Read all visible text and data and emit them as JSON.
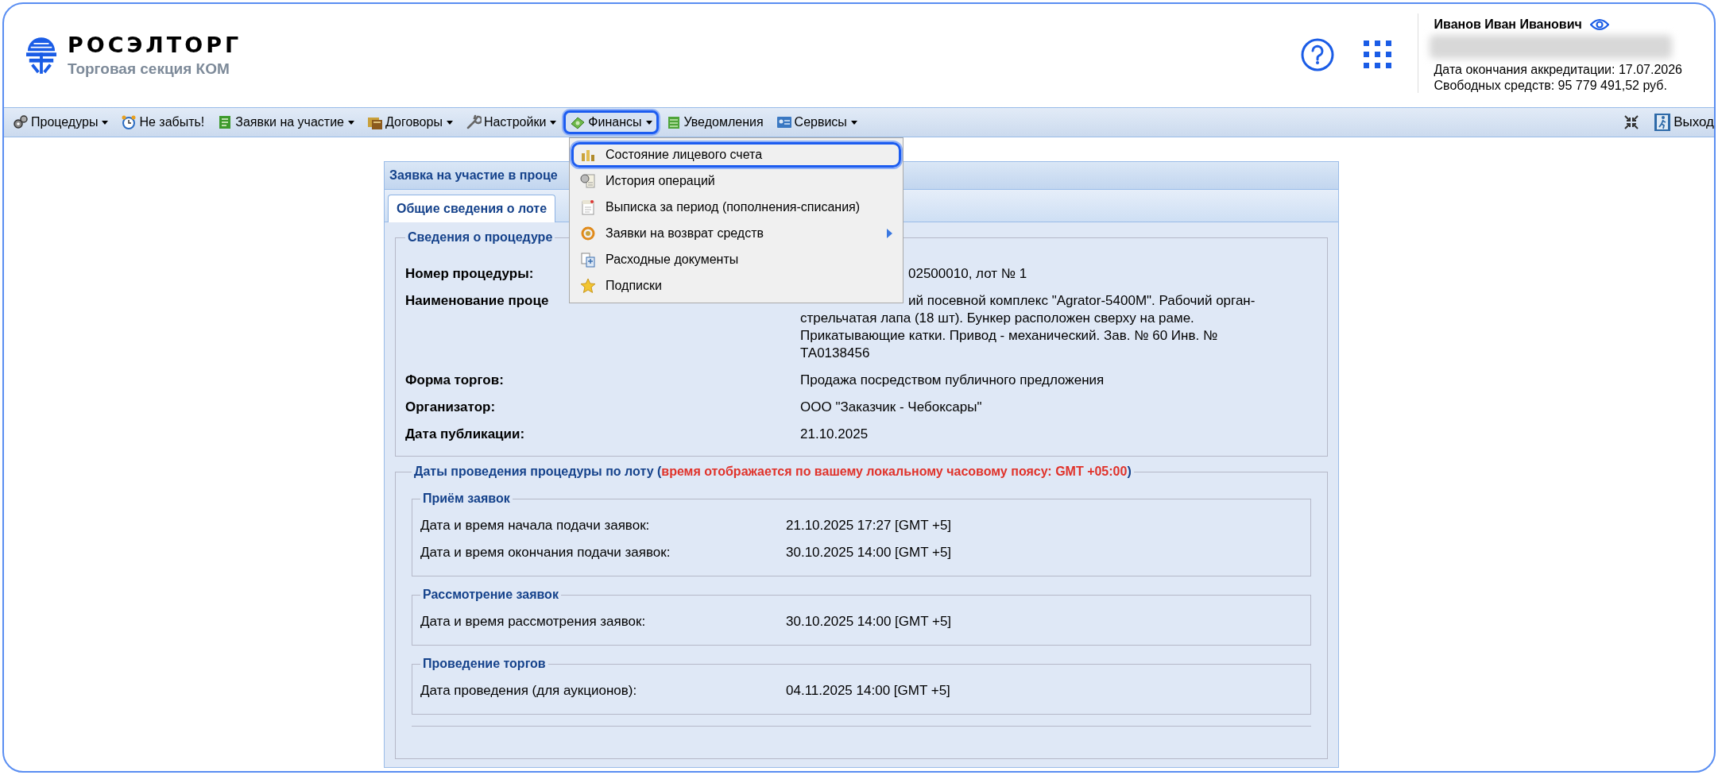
{
  "header": {
    "logo_title": "РОСЭЛТОРГ",
    "logo_subtitle": "Торговая секция КОМ",
    "user": {
      "name": "Иванов Иван Иванович",
      "accreditation": "Дата окончания аккредитации: 17.07.2026",
      "funds": "Свободных средств: 95 779 491,52 руб."
    }
  },
  "toolbar": {
    "items": [
      {
        "label": "Процедуры",
        "dropdown": true,
        "selected": false
      },
      {
        "label": "Не забыть!",
        "dropdown": false,
        "selected": false
      },
      {
        "label": "Заявки на участие",
        "dropdown": true,
        "selected": false
      },
      {
        "label": "Договоры",
        "dropdown": true,
        "selected": false
      },
      {
        "label": "Настройки",
        "dropdown": true,
        "selected": false
      },
      {
        "label": "Финансы",
        "dropdown": true,
        "selected": true
      },
      {
        "label": "Уведомления",
        "dropdown": false,
        "selected": false
      },
      {
        "label": "Сервисы",
        "dropdown": true,
        "selected": false
      }
    ],
    "exit_label": "Выход"
  },
  "menu": {
    "items": [
      {
        "label": "Состояние лицевого счета",
        "submenu": false,
        "selected": true
      },
      {
        "label": "История операций",
        "submenu": false,
        "selected": false
      },
      {
        "label": "Выписка за период (пополнения-списания)",
        "submenu": false,
        "selected": false
      },
      {
        "label": "Заявки на возврат средств",
        "submenu": true,
        "selected": false
      },
      {
        "label": "Расходные документы",
        "submenu": false,
        "selected": false
      },
      {
        "label": "Подписки",
        "submenu": false,
        "selected": false
      }
    ]
  },
  "panel": {
    "title": "Заявка на участие в проце",
    "tabs": [
      {
        "label": "Общие сведения о лоте",
        "selected": true
      }
    ],
    "procedure": {
      "legend": "Сведения о процедуре",
      "rows": [
        {
          "label": "Номер процедуры:",
          "value": "02500010, лот № 1"
        },
        {
          "label": "Наименование проце",
          "value": "ий посевной комплекс \"Agrator-5400M\". Рабочий орган-стрельчатая лапа (18 шт). Бункер расположен сверху на раме. Прикатывающие катки. Привод - механический. Зав. № 60 Инв. № ТА0138456"
        },
        {
          "label": "Форма торгов:",
          "value": "Продажа посредством публичного предложения"
        },
        {
          "label": "Организатор:",
          "value": "ООО \"Заказчик - Чебоксары\""
        },
        {
          "label": "Дата публикации:",
          "value": "21.10.2025"
        }
      ]
    },
    "dates": {
      "legend_parts": [
        {
          "kind": "plain",
          "text": "Даты проведения процедуры по лоту ("
        },
        {
          "kind": "warning",
          "text": "время отображается по вашему локальному часовому поясу: GMT +05:00"
        },
        {
          "kind": "plain",
          "text": ")"
        }
      ],
      "groups": [
        {
          "legend": "Приём заявок",
          "rows": [
            {
              "label": "Дата и время начала подачи заявок:",
              "value": "21.10.2025 17:27 [GMT +5]"
            },
            {
              "label": "Дата и время окончания подачи заявок:",
              "value": "30.10.2025 14:00 [GMT +5]"
            }
          ]
        },
        {
          "legend": "Рассмотрение заявок",
          "rows": [
            {
              "label": "Дата и время рассмотрения заявок:",
              "value": "30.10.2025 14:00 [GMT +5]"
            }
          ]
        },
        {
          "legend": "Проведение торгов",
          "rows": [
            {
              "label": "Дата проведения (для аукционов):",
              "value": "04.11.2025 14:00 [GMT +5]"
            }
          ]
        }
      ]
    }
  }
}
